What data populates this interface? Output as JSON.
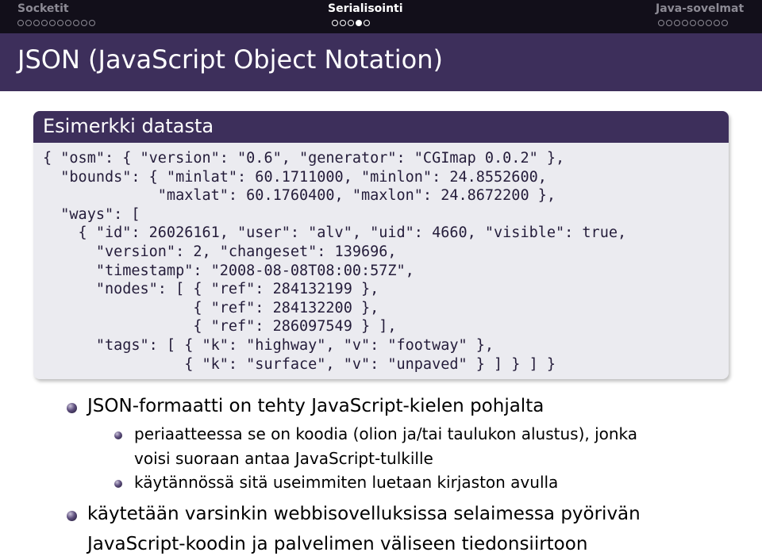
{
  "navbar": {
    "sections": [
      {
        "label": "Socketit",
        "dots": 10,
        "filled": -1,
        "active": false
      },
      {
        "label": "Serialisointi",
        "dots": 5,
        "filled": 3,
        "active": true
      },
      {
        "label": "Java-sovelmat",
        "dots": 9,
        "filled": -1,
        "active": false
      }
    ]
  },
  "frame": {
    "title": "JSON (JavaScript Object Notation)"
  },
  "example_block": {
    "title": "Esimerkki datasta",
    "code_lines": [
      "{ \"osm\": { \"version\": \"0.6\", \"generator\": \"CGImap 0.0.2\" },",
      "  \"bounds\": { \"minlat\": 60.1711000, \"minlon\": 24.8552600,",
      "             \"maxlat\": 60.1760400, \"maxlon\": 24.8672200 },",
      "  \"ways\": [",
      "    { \"id\": 26026161, \"user\": \"alv\", \"uid\": 4660, \"visible\": true,",
      "      \"version\": 2, \"changeset\": 139696,",
      "      \"timestamp\": \"2008-08-08T08:00:57Z\",",
      "      \"nodes\": [ { \"ref\": 284132199 },",
      "                 { \"ref\": 284132200 },",
      "                 { \"ref\": 286097549 } ],",
      "      \"tags\": [ { \"k\": \"highway\", \"v\": \"footway\" },",
      "                { \"k\": \"surface\", \"v\": \"unpaved\" } ] } ] }"
    ]
  },
  "bullets": {
    "item1": "JSON-formaatti on tehty JavaScript-kielen pohjalta",
    "sub1_line1": "periaatteessa se on koodia (olion ja/tai taulukon alustus), jonka",
    "sub1_line2": "voisi suoraan antaa JavaScript-tulkille",
    "sub2": "käytännössä sitä useimmiten luetaan kirjaston avulla",
    "item2_line1": "käytetään varsinkin webbisovelluksissa selaimessa pyörivän",
    "item2_line2": "JavaScript-koodin ja palvelimen väliseen tiedonsiirtoon"
  },
  "colors": {
    "navbar_bg": "#120f1a",
    "title_bg": "#3d2f5b",
    "block_body_bg": "#ebebf0",
    "code_text": "#241c3a"
  }
}
